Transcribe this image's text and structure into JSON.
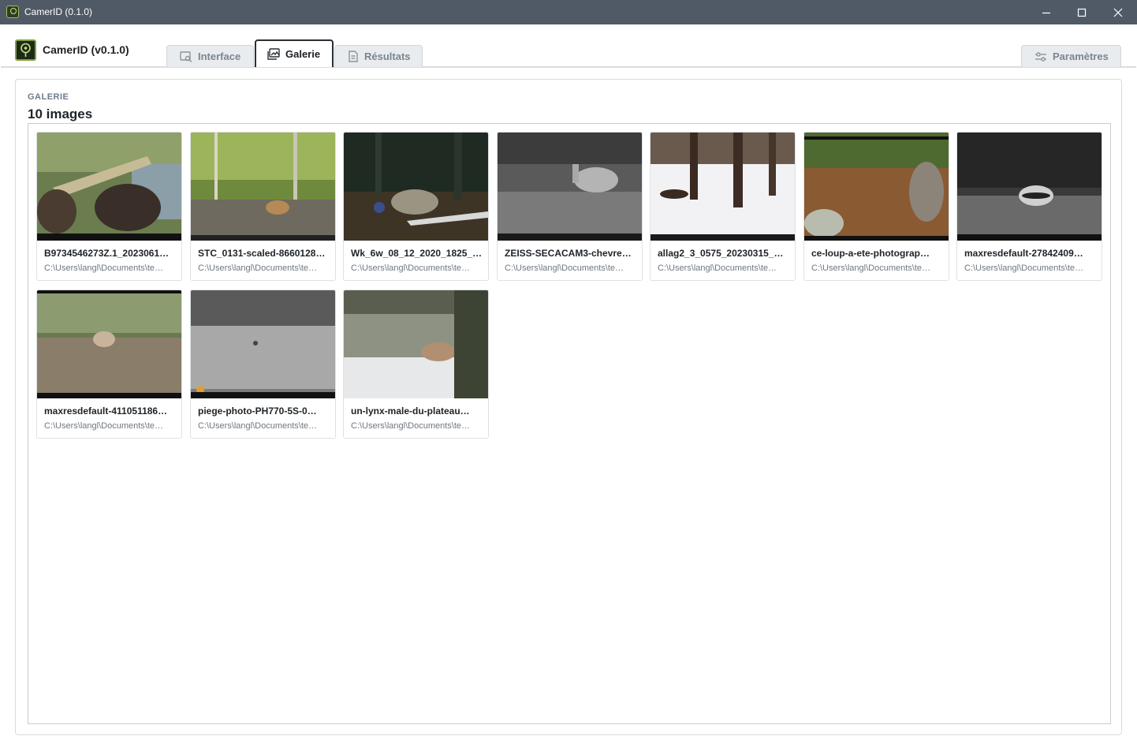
{
  "window": {
    "title": "CamerID (0.1.0)"
  },
  "header": {
    "brand": "CamerID (v0.1.0)",
    "tabs": [
      {
        "label": "Interface",
        "icon": "image-search-icon",
        "active": false
      },
      {
        "label": "Galerie",
        "icon": "gallery-icon",
        "active": true
      },
      {
        "label": "Résultats",
        "icon": "document-icon",
        "active": false
      }
    ],
    "settings_label": "Paramètres"
  },
  "gallery": {
    "section_label": "GALERIE",
    "count_label": "10 images",
    "images": [
      {
        "name": "B9734546273Z.1_2023061…",
        "path": "C:\\Users\\langl\\Documents\\te…",
        "scene": "boar"
      },
      {
        "name": "STC_0131-scaled-8660128…",
        "path": "C:\\Users\\langl\\Documents\\te…",
        "scene": "deer-forest"
      },
      {
        "name": "Wk_6w_08_12_2020_1825_…",
        "path": "C:\\Users\\langl\\Documents\\te…",
        "scene": "wildcat-night"
      },
      {
        "name": "ZEISS-SECACAM3-chevre…",
        "path": "C:\\Users\\langl\\Documents\\te…",
        "scene": "roe-ir"
      },
      {
        "name": "allag2_3_0575_20230315_…",
        "path": "C:\\Users\\langl\\Documents\\te…",
        "scene": "marten-snow"
      },
      {
        "name": "ce-loup-a-ete-photograp…",
        "path": "C:\\Users\\langl\\Documents\\te…",
        "scene": "wolf"
      },
      {
        "name": "maxresdefault-27842409…",
        "path": "C:\\Users\\langl\\Documents\\te…",
        "scene": "badger-ir"
      },
      {
        "name": "maxresdefault-411051186…",
        "path": "C:\\Users\\langl\\Documents\\te…",
        "scene": "fox"
      },
      {
        "name": "piege-photo-PH770-5S-0…",
        "path": "C:\\Users\\langl\\Documents\\te…",
        "scene": "field-gray"
      },
      {
        "name": "un-lynx-male-du-plateau…",
        "path": "C:\\Users\\langl\\Documents\\te…",
        "scene": "lynx-snow"
      }
    ]
  }
}
